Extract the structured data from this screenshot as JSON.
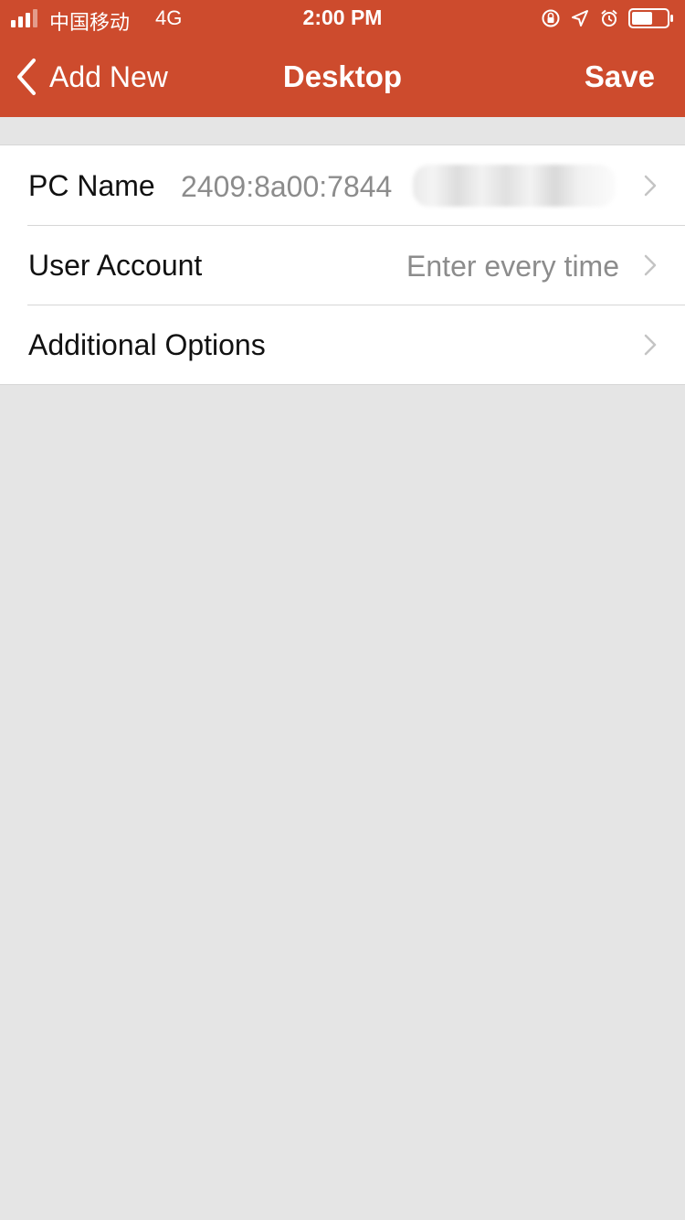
{
  "status_bar": {
    "carrier": "中国移动",
    "network": "4G",
    "time": "2:00 PM",
    "icons": [
      "signal-icon",
      "orientation-lock-icon",
      "location-icon",
      "alarm-icon",
      "battery-icon"
    ]
  },
  "nav": {
    "back_label": "Add New",
    "title": "Desktop",
    "save_label": "Save"
  },
  "rows": [
    {
      "label": "PC Name",
      "value": "2409:8a00:7844"
    },
    {
      "label": "User Account",
      "value": "Enter every time"
    },
    {
      "label": "Additional Options",
      "value": ""
    }
  ],
  "colors": {
    "accent": "#cd4b2d",
    "background": "#e5e5e5",
    "value_text": "#8c8c8c"
  }
}
